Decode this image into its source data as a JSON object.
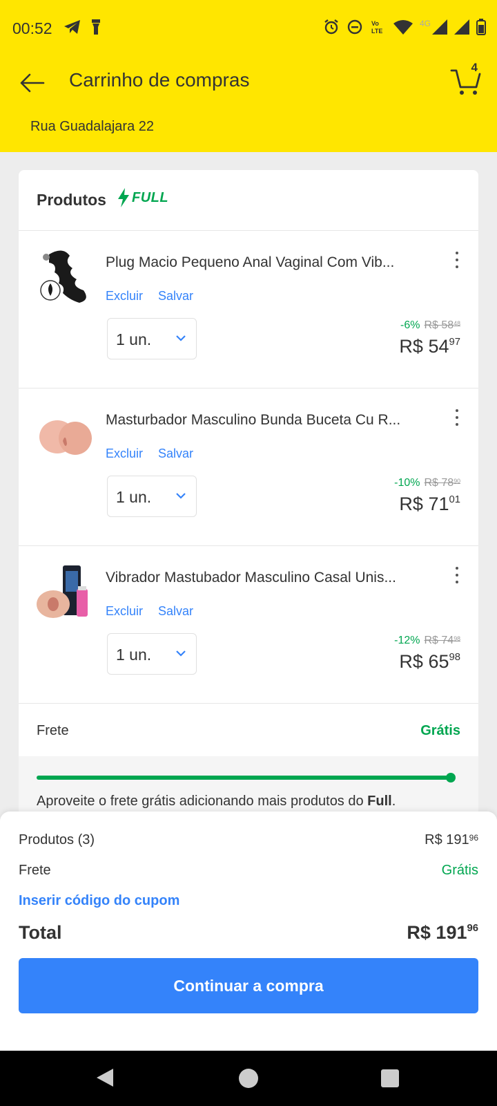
{
  "status": {
    "time": "00:52",
    "network_label": "4G",
    "volte_label": "VoLTE"
  },
  "header": {
    "title": "Carrinho de compras",
    "cart_count": "4",
    "address": "Rua Guadalajara 22"
  },
  "products_card": {
    "title": "Produtos",
    "badge": "FULL",
    "items": [
      {
        "title": "Plug Macio Pequeno Anal Vaginal Com Vib...",
        "remove_label": "Excluir",
        "save_label": "Salvar",
        "quantity": "1 un.",
        "discount": "-6%",
        "old_price_int": "R$ 58",
        "old_price_cents": "48",
        "price_int": "R$ 54",
        "price_cents": "97",
        "thumb_icon": "plug-product-image"
      },
      {
        "title": "Masturbador Masculino Bunda Buceta Cu R...",
        "remove_label": "Excluir",
        "save_label": "Salvar",
        "quantity": "1 un.",
        "discount": "-10%",
        "old_price_int": "R$ 78",
        "old_price_cents": "90",
        "price_int": "R$ 71",
        "price_cents": "01",
        "thumb_icon": "masturbator-product-image"
      },
      {
        "title": "Vibrador Mastubador Masculino Casal Unis...",
        "remove_label": "Excluir",
        "save_label": "Salvar",
        "quantity": "1 un.",
        "discount": "-12%",
        "old_price_int": "R$ 74",
        "old_price_cents": "98",
        "price_int": "R$ 65",
        "price_cents": "98",
        "thumb_icon": "vibrator-kit-product-image"
      }
    ],
    "shipping_label": "Frete",
    "shipping_value": "Grátis",
    "free_shipping_progress": 1.0,
    "promo_text_before": "Aproveite o frete grátis adicionando mais produtos do ",
    "promo_text_bold": "Full",
    "promo_text_after": "."
  },
  "summary": {
    "products_label": "Produtos (3)",
    "products_total_int": "R$ 191",
    "products_total_cents": "96",
    "shipping_label": "Frete",
    "shipping_value": "Grátis",
    "coupon_label": "Inserir código do cupom",
    "total_label": "Total",
    "total_int": "R$ 191",
    "total_cents": "96",
    "cta_label": "Continuar a compra"
  },
  "colors": {
    "header_yellow": "#ffe600",
    "link_blue": "#3483fa",
    "green": "#00a650"
  }
}
